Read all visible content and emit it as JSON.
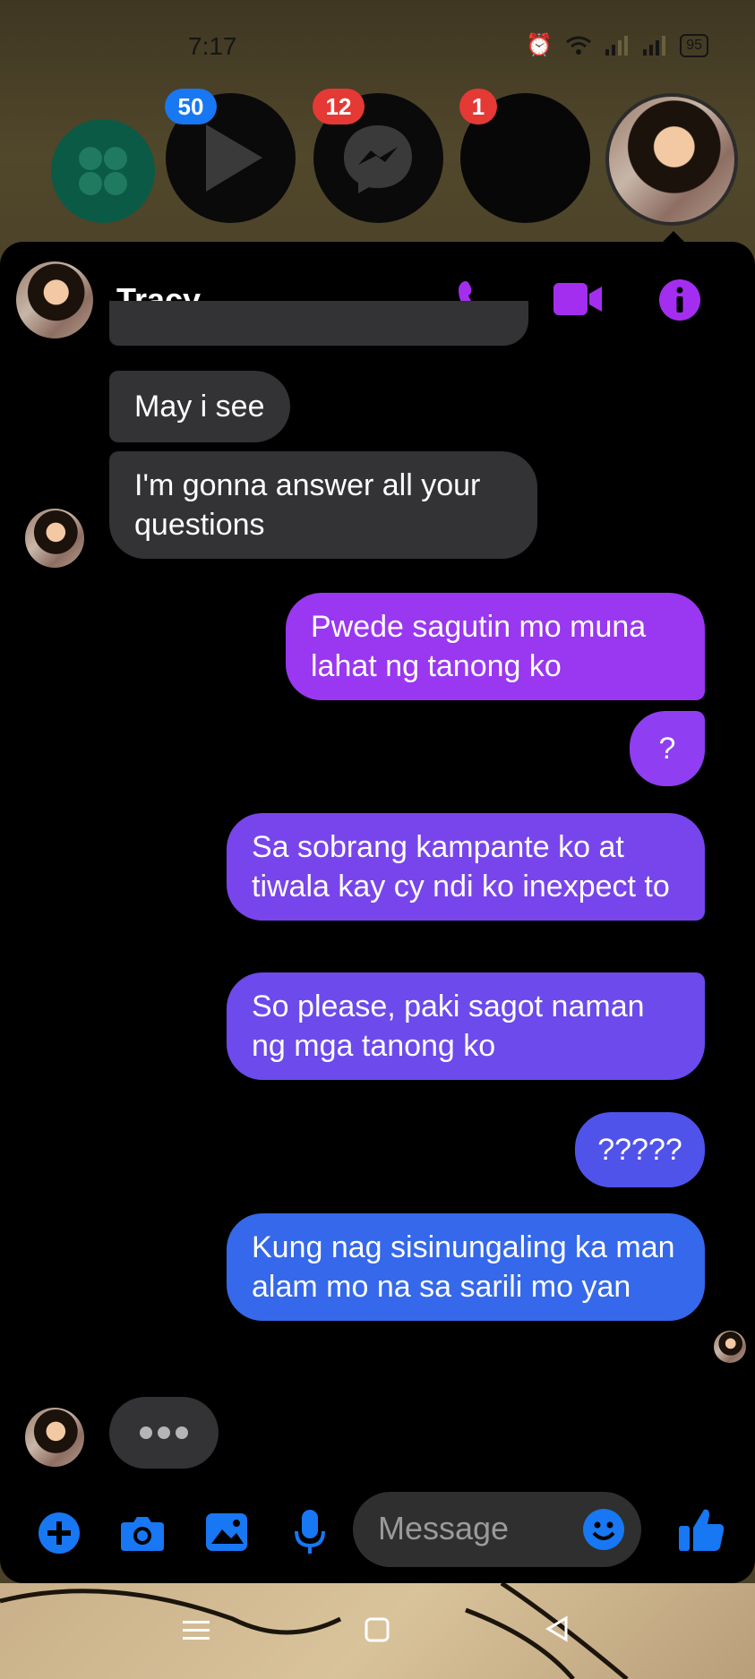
{
  "status_bar": {
    "time": "7:17",
    "battery": "95"
  },
  "chat_heads": [
    {
      "badge": "50",
      "badge_color": "#1877f2"
    },
    {
      "badge": "12",
      "badge_color": "#e53935"
    },
    {
      "badge": "1",
      "badge_color": "#e53935"
    }
  ],
  "header": {
    "contact_name": "Tracy"
  },
  "messages": [
    {
      "text": "May i see"
    },
    {
      "text": "I'm gonna answer all your questions"
    },
    {
      "text": "Pwede sagutin mo muna lahat ng tanong ko"
    },
    {
      "text": "?"
    },
    {
      "text": "Sa sobrang kampante ko at tiwala kay cy ndi ko inexpect to"
    },
    {
      "text": "So please, paki sagot naman ng mga tanong ko"
    },
    {
      "text": "?????"
    },
    {
      "text": "Kung nag sisinungaling ka man alam mo na sa sarili mo yan"
    }
  ],
  "composer": {
    "placeholder": "Message"
  },
  "colors": {
    "accent_purple": "#a42ef0",
    "accent_blue": "#1877f2",
    "incoming_bubble": "#333336"
  }
}
